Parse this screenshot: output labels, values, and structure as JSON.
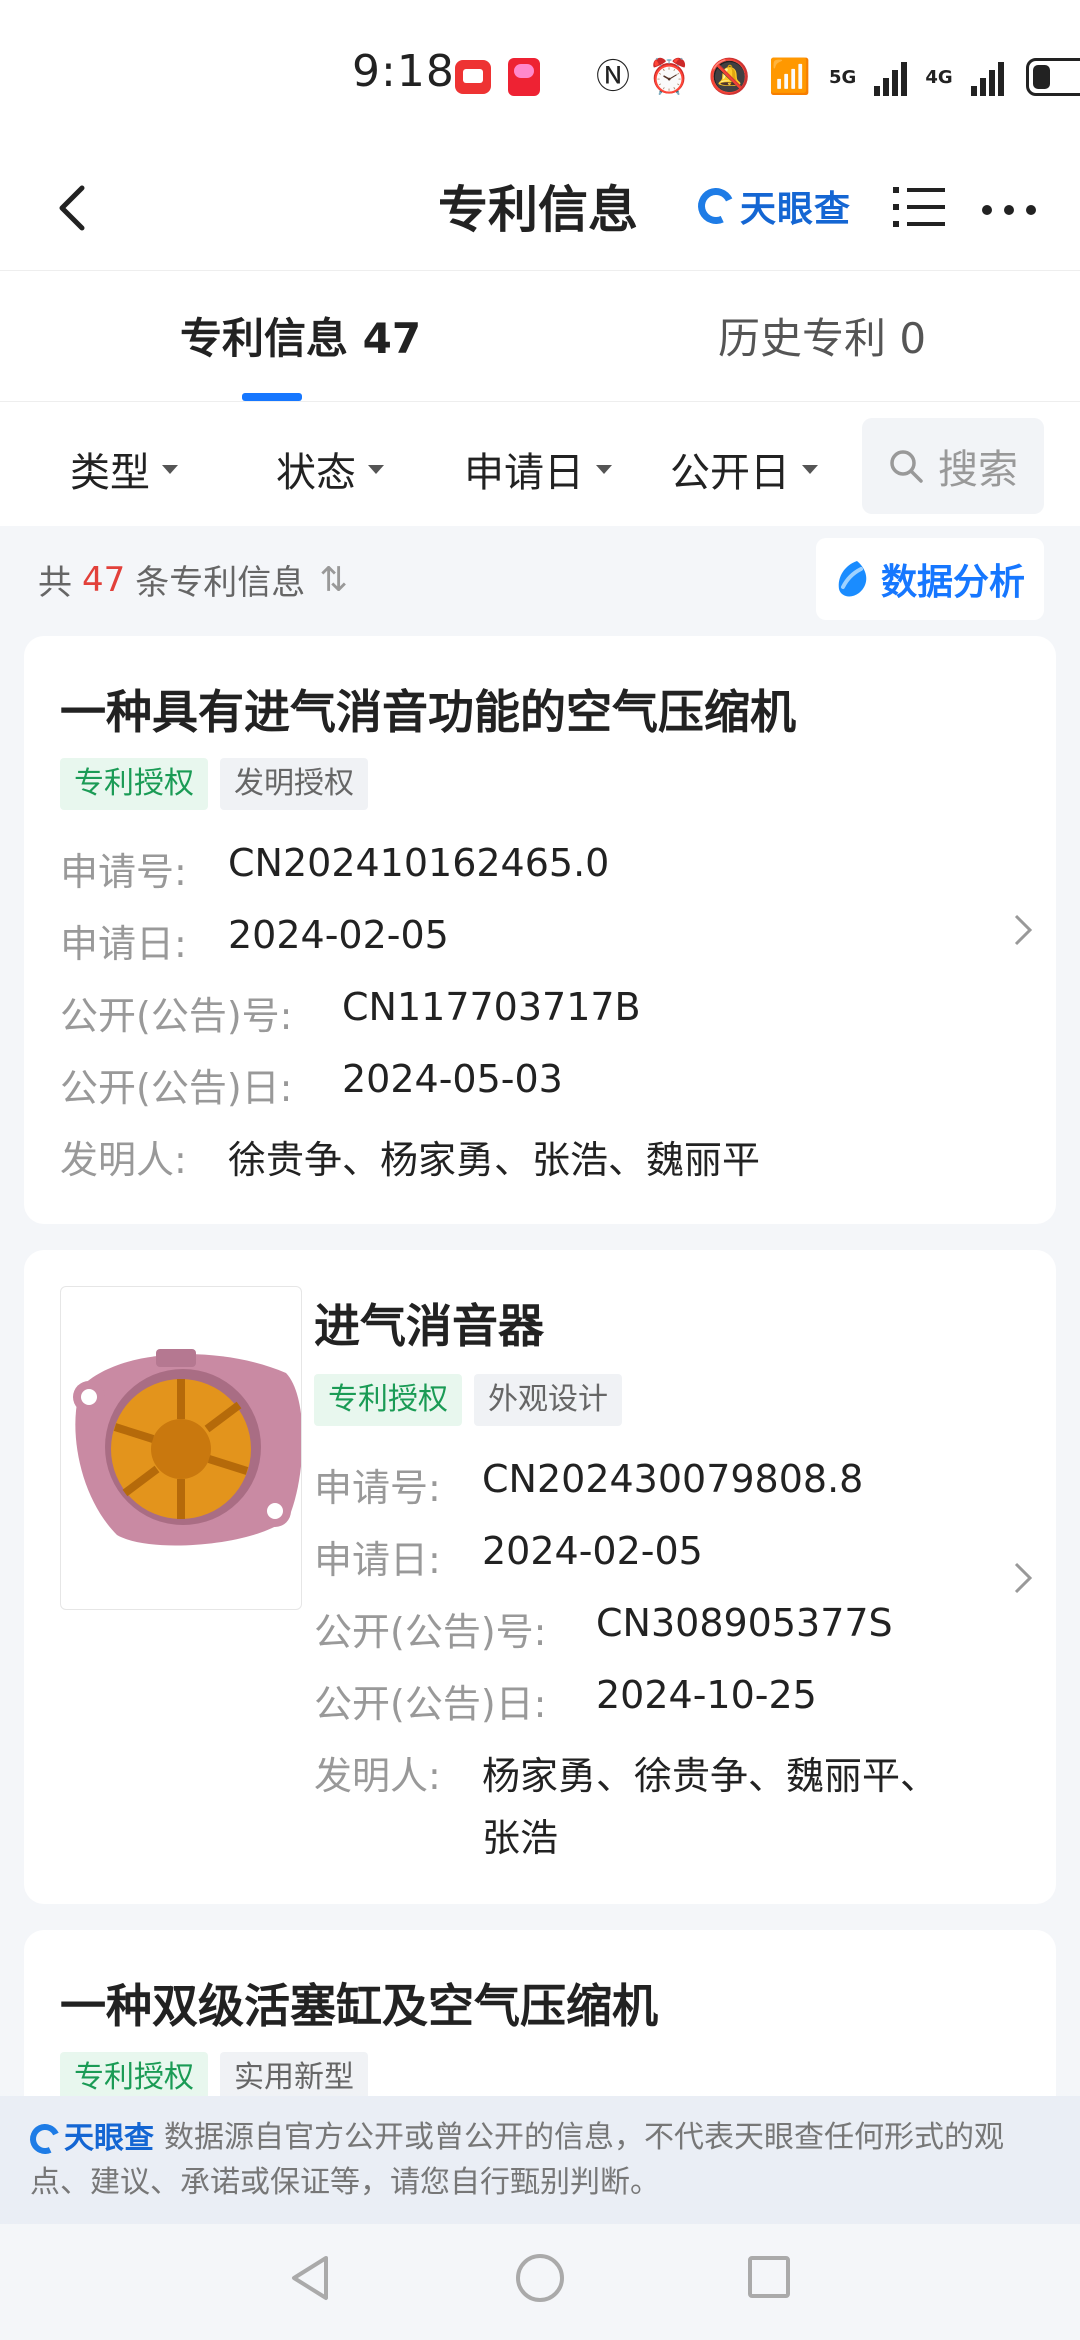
{
  "status_bar": {
    "time": "9:18",
    "net1": "5G",
    "net2": "4G",
    "battery_level": 0.3
  },
  "header": {
    "title": "专利信息",
    "brand": "天眼查"
  },
  "tabs": [
    {
      "label": "专利信息 47"
    },
    {
      "label": "历史专利 0"
    }
  ],
  "filters": {
    "type": "类型",
    "status": "状态",
    "apply_date": "申请日",
    "publish_date": "公开日",
    "search_label": "搜索"
  },
  "summary": {
    "prefix": "共",
    "count": "47",
    "suffix": "条专利信息"
  },
  "analysis_button": "数据分析",
  "field_labels": {
    "app_no": "申请号:",
    "app_date": "申请日:",
    "pub_no": "公开(公告)号:",
    "pub_date": "公开(公告)日:",
    "inventors": "发明人:"
  },
  "patents": [
    {
      "title": "一种具有进气消音功能的空气压缩机",
      "tags": [
        "专利授权",
        "发明授权"
      ],
      "app_no": "CN202410162465.0",
      "app_date": "2024-02-05",
      "pub_no": "CN117703717B",
      "pub_date": "2024-05-03",
      "inventors": "徐贵争、杨家勇、张浩、魏丽平"
    },
    {
      "title": "进气消音器",
      "tags": [
        "专利授权",
        "外观设计"
      ],
      "app_no": "CN202430079808.8",
      "app_date": "2024-02-05",
      "pub_no": "CN308905377S",
      "pub_date": "2024-10-25",
      "inventors_line1": "杨家勇、徐贵争、魏丽平、",
      "inventors_line2": "张浩"
    },
    {
      "title": "一种双级活塞缸及空气压缩机",
      "tags": [
        "专利授权",
        "实用新型"
      ]
    }
  ],
  "disclaimer": {
    "brand": "天眼查",
    "text": "数据源自官方公开或曾公开的信息，不代表天眼查任何形式的观点、建议、承诺或保证等，请您自行甄别判断。"
  },
  "colors": {
    "accent": "#1677ff",
    "count_red": "#e2403a",
    "tag_green": "#1a9b55"
  }
}
